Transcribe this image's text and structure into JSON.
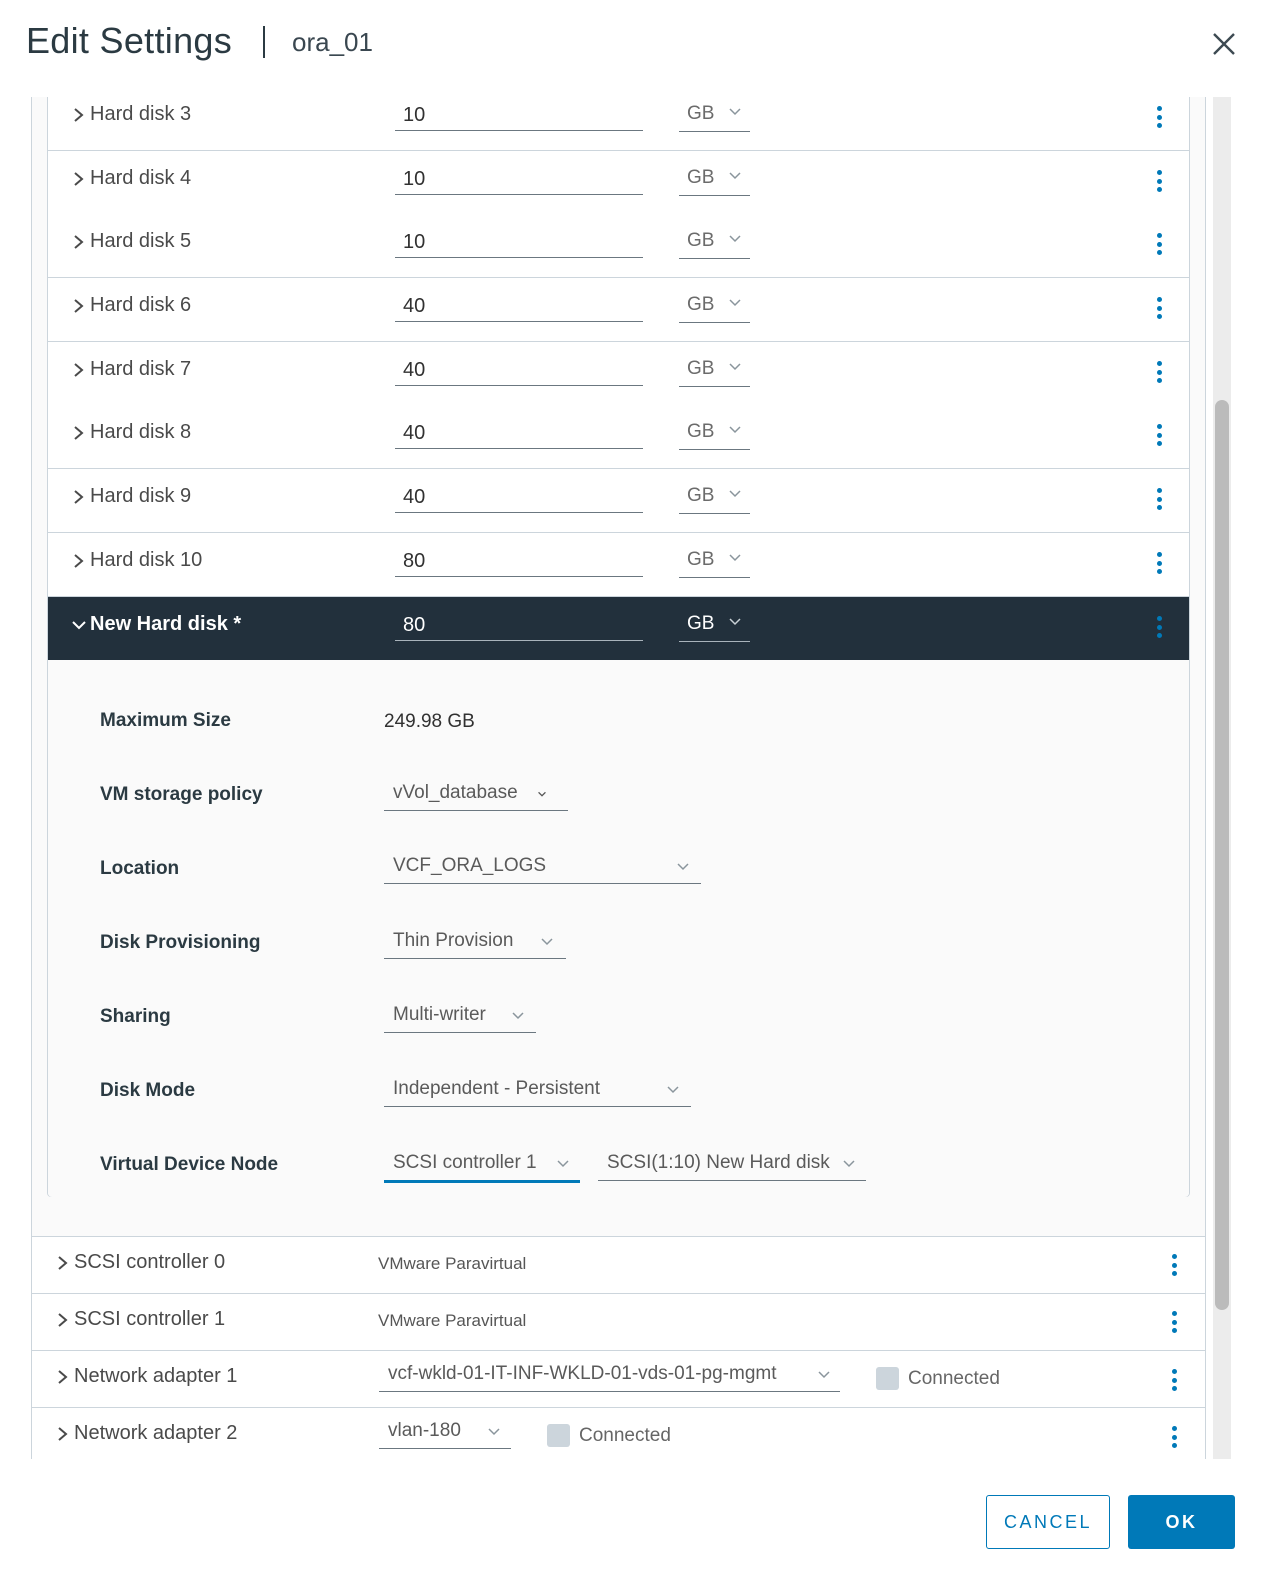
{
  "header": {
    "title": "Edit Settings",
    "vm_name": "ora_01",
    "close_icon": "close-icon"
  },
  "hard_disks": [
    {
      "label": "Hard disk 3",
      "size": "10",
      "unit": "GB",
      "expanded": false
    },
    {
      "label": "Hard disk 4",
      "size": "10",
      "unit": "GB",
      "expanded": false
    },
    {
      "label": "Hard disk 5",
      "size": "10",
      "unit": "GB",
      "expanded": false
    },
    {
      "label": "Hard disk 6",
      "size": "40",
      "unit": "GB",
      "expanded": false
    },
    {
      "label": "Hard disk 7",
      "size": "40",
      "unit": "GB",
      "expanded": false
    },
    {
      "label": "Hard disk 8",
      "size": "40",
      "unit": "GB",
      "expanded": false
    },
    {
      "label": "Hard disk 9",
      "size": "40",
      "unit": "GB",
      "expanded": false
    },
    {
      "label": "Hard disk 10",
      "size": "80",
      "unit": "GB",
      "expanded": false
    }
  ],
  "new_disk": {
    "label": "New Hard disk *",
    "size": "80",
    "unit": "GB",
    "expanded": true,
    "details": {
      "max_size": {
        "label": "Maximum Size",
        "value": "249.98 GB"
      },
      "storage_policy": {
        "label": "VM storage policy",
        "value": "vVol_database"
      },
      "location": {
        "label": "Location",
        "value": "VCF_ORA_LOGS"
      },
      "provisioning": {
        "label": "Disk Provisioning",
        "value": "Thin Provision"
      },
      "sharing": {
        "label": "Sharing",
        "value": "Multi-writer"
      },
      "disk_mode": {
        "label": "Disk Mode",
        "value": "Independent - Persistent"
      },
      "device_node": {
        "label": "Virtual Device Node",
        "controller": "SCSI controller 1",
        "node": "SCSI(1:10) New Hard disk"
      }
    }
  },
  "devices": [
    {
      "label": "SCSI controller 0",
      "value": "VMware Paravirtual"
    },
    {
      "label": "SCSI controller 1",
      "value": "VMware Paravirtual"
    },
    {
      "label": "Network adapter 1",
      "network": "vcf-wkld-01-IT-INF-WKLD-01-vds-01-pg-mgmt",
      "connected_label": "Connected",
      "connected": false
    },
    {
      "label": "Network adapter 2",
      "network": "vlan-180",
      "connected_label": "Connected",
      "connected": false
    }
  ],
  "footer": {
    "cancel_label": "CANCEL",
    "ok_label": "OK"
  },
  "colors": {
    "accent": "#0079b8",
    "selected_row": "#22303c",
    "border": "#ccd5dc"
  }
}
